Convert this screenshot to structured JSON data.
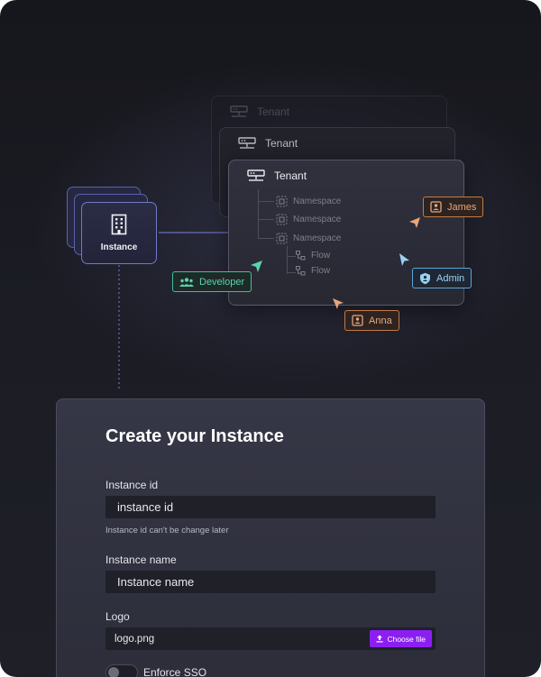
{
  "diagram": {
    "tenants": [
      {
        "label": "Tenant"
      },
      {
        "label": "Tenant"
      },
      {
        "label": "Tenant"
      }
    ],
    "namespaces": [
      "Namespace",
      "Namespace",
      "Namespace"
    ],
    "flows": [
      "Flow",
      "Flow"
    ],
    "instance_label": "Instance",
    "tags": {
      "james": "James",
      "developer": "Developer",
      "admin": "Admin",
      "anna": "Anna"
    },
    "colors": {
      "instance_border": "#7378c4",
      "tag_orange": "#e8a67a",
      "tag_green": "#5ad3ad",
      "tag_blue": "#9ad2f4",
      "accent_button": "#8b1ff2"
    }
  },
  "form": {
    "title": "Create your Instance",
    "instance_id": {
      "label": "Instance id",
      "value": "instance id",
      "hint": "Instance id can't be change later"
    },
    "instance_name": {
      "label": "Instance name",
      "value": "Instance name"
    },
    "logo": {
      "label": "Logo",
      "file": "logo.png",
      "button": "Choose file"
    },
    "sso": {
      "label": "Enforce SSO",
      "enabled": false
    }
  }
}
